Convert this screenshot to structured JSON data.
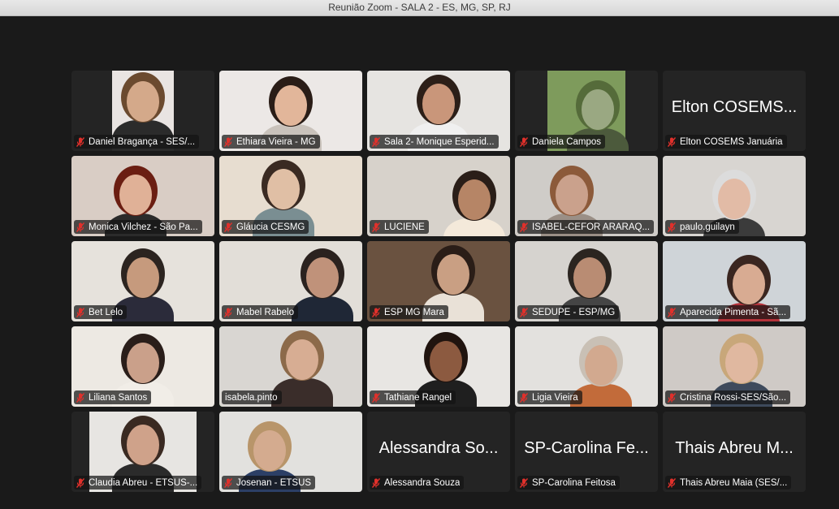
{
  "window": {
    "title": "Reunião Zoom - SALA 2 - ES, MG, SP, RJ"
  },
  "colors": {
    "mute_icon": "#e0302b",
    "active_speaker_border": "#4fc94f",
    "tile_bg": "#242424"
  },
  "participants": [
    {
      "name": "Daniel Bragança - SES/...",
      "video": true,
      "muted": true
    },
    {
      "name": "Ethiara Vieira - MG",
      "video": true,
      "muted": true
    },
    {
      "name": "Sala 2- Monique Esperid...",
      "video": true,
      "muted": true
    },
    {
      "name": "Daniela Campos",
      "video": true,
      "muted": true
    },
    {
      "name": "Elton COSEMS Januária",
      "big_name": "Elton COSEMS...",
      "video": false,
      "muted": true
    },
    {
      "name": "Monica Vilchez - São Pa...",
      "video": true,
      "muted": true
    },
    {
      "name": "Gláucia CESMG",
      "video": true,
      "muted": true
    },
    {
      "name": "LUCIENE",
      "video": true,
      "muted": true
    },
    {
      "name": "ISABEL-CEFOR ARARAQ...",
      "video": true,
      "muted": true
    },
    {
      "name": "paulo.guilayn",
      "video": true,
      "muted": true
    },
    {
      "name": "Bet Lelo",
      "video": true,
      "muted": true
    },
    {
      "name": "Mabel Rabelo",
      "video": true,
      "muted": true
    },
    {
      "name": "ESP MG Mara",
      "video": true,
      "muted": true
    },
    {
      "name": "SEDUPE - ESP/MG",
      "video": true,
      "muted": true
    },
    {
      "name": "Aparecida Pimenta - Sã...",
      "video": true,
      "muted": true
    },
    {
      "name": "Liliana Santos",
      "video": true,
      "muted": true
    },
    {
      "name": "isabela.pinto",
      "video": true,
      "muted": false,
      "active": true
    },
    {
      "name": "Tathiane Rangel",
      "video": true,
      "muted": true
    },
    {
      "name": "Ligia  Vieira",
      "video": true,
      "muted": true
    },
    {
      "name": "Cristina Rossi-SES/São...",
      "video": true,
      "muted": true
    },
    {
      "name": "Claudia Abreu - ETSUS-...",
      "video": true,
      "muted": true
    },
    {
      "name": "Josenan - ETSUS",
      "video": true,
      "muted": true
    },
    {
      "name": "Alessandra Souza",
      "big_name": "Alessandra So...",
      "video": false,
      "muted": true
    },
    {
      "name": "SP-Carolina Feitosa",
      "big_name": "SP-Carolina Fe...",
      "video": false,
      "muted": true
    },
    {
      "name": "Thais Abreu Maia (SES/...",
      "big_name": "Thais Abreu M...",
      "video": false,
      "muted": true
    }
  ]
}
